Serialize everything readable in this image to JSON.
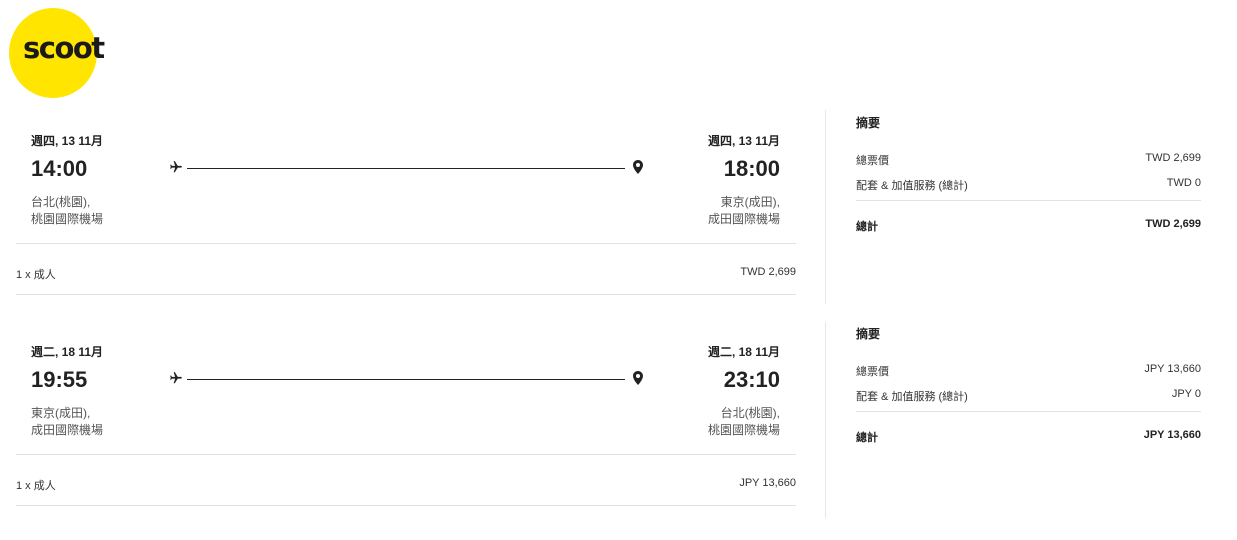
{
  "brand": {
    "logo_text": "scoot",
    "color": "#ffe500"
  },
  "flights": [
    {
      "departure": {
        "date": "週四, 13 11月",
        "time": "14:00",
        "city": "台北(桃園),",
        "airport": "桃園國際機場"
      },
      "arrival": {
        "date": "週四, 13 11月",
        "time": "18:00",
        "city": "東京(成田),",
        "airport": "成田國際機場"
      },
      "passengers": "1 x 成人",
      "fare": "TWD 2,699"
    },
    {
      "departure": {
        "date": "週二, 18 11月",
        "time": "19:55",
        "city": "東京(成田),",
        "airport": "成田國際機場"
      },
      "arrival": {
        "date": "週二, 18 11月",
        "time": "23:10",
        "city": "台北(桃園),",
        "airport": "桃園國際機場"
      },
      "passengers": "1 x 成人",
      "fare": "JPY 13,660"
    }
  ],
  "summaries": [
    {
      "title": "摘要",
      "ticket_label": "總票價",
      "ticket_value": "TWD 2,699",
      "addons_label": "配套 & 加值服務 (總計)",
      "addons_value": "TWD 0",
      "total_label": "總計",
      "total_value": "TWD 2,699"
    },
    {
      "title": "摘要",
      "ticket_label": "總票價",
      "ticket_value": "JPY 13,660",
      "addons_label": "配套 & 加值服務 (總計)",
      "addons_value": "JPY 0",
      "total_label": "總計",
      "total_value": "JPY 13,660"
    }
  ],
  "icons": {
    "plane": "plane-icon",
    "pin": "location-pin-icon"
  }
}
